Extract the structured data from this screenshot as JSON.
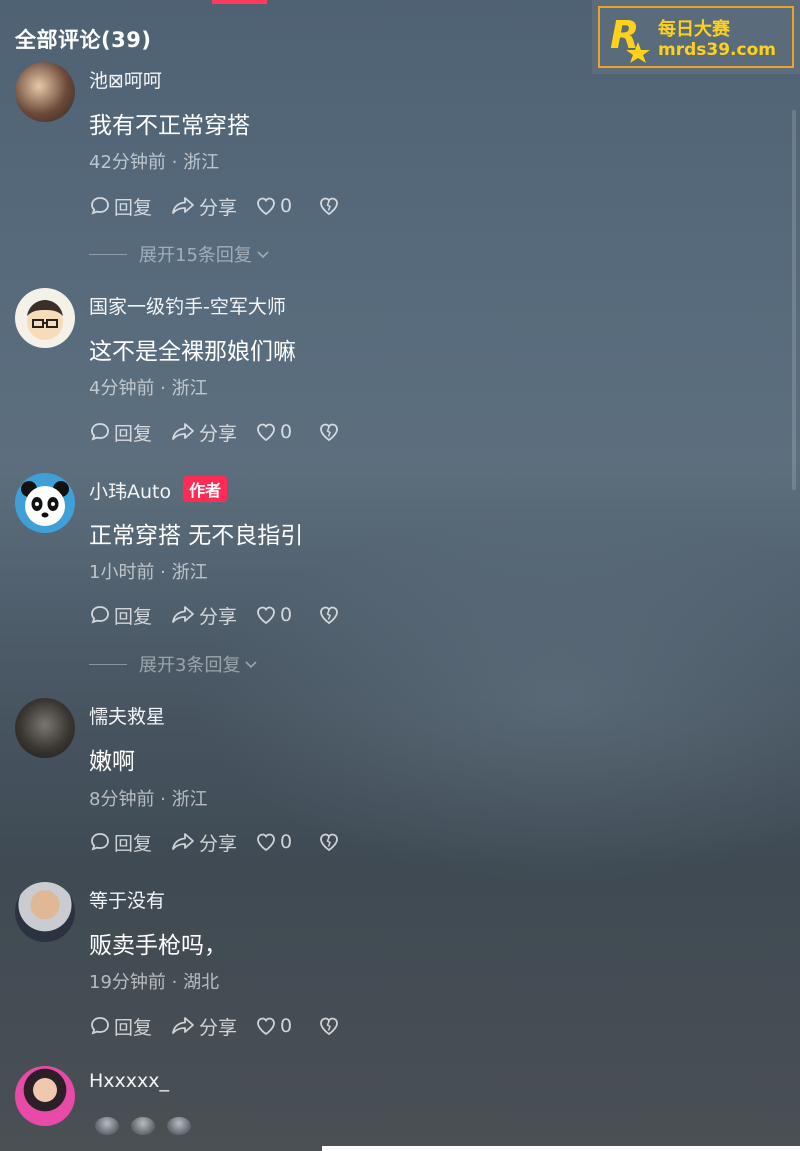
{
  "header": {
    "title": "全部评论(39)"
  },
  "watermark": {
    "line1": "每日大赛",
    "line2": "mrds39.com"
  },
  "actions": {
    "reply": "回复",
    "share": "分享"
  },
  "comments": [
    {
      "username": "池⊠呵呵",
      "content": "我有不正常穿搭",
      "meta": "42分钟前 · 浙江",
      "likes": "0",
      "expand": "展开15条回复",
      "avatar": "avatar-photo-couple"
    },
    {
      "username": "国家一级钓手-空军大师",
      "content": "这不是全裸那娘们嘛",
      "meta": "4分钟前 · 浙江",
      "likes": "0",
      "avatar": "avatar-cartoon-glasses"
    },
    {
      "username": "小玮Auto",
      "badge": "作者",
      "content": "正常穿搭 无不良指引",
      "meta": "1小时前 · 浙江",
      "likes": "0",
      "expand": "展开3条回复",
      "avatar": "avatar-panda"
    },
    {
      "username": "懦夫救星",
      "content": "嫩啊",
      "meta": "8分钟前 · 浙江",
      "likes": "0",
      "avatar": "avatar-dark-figure"
    },
    {
      "username": "等于没有",
      "content": "贩卖手枪吗，",
      "meta": "19分钟前 · 湖北",
      "likes": "0",
      "avatar": "avatar-man-suit"
    },
    {
      "username": "Hxxxxx_",
      "avatar": "avatar-woman-pink"
    }
  ]
}
